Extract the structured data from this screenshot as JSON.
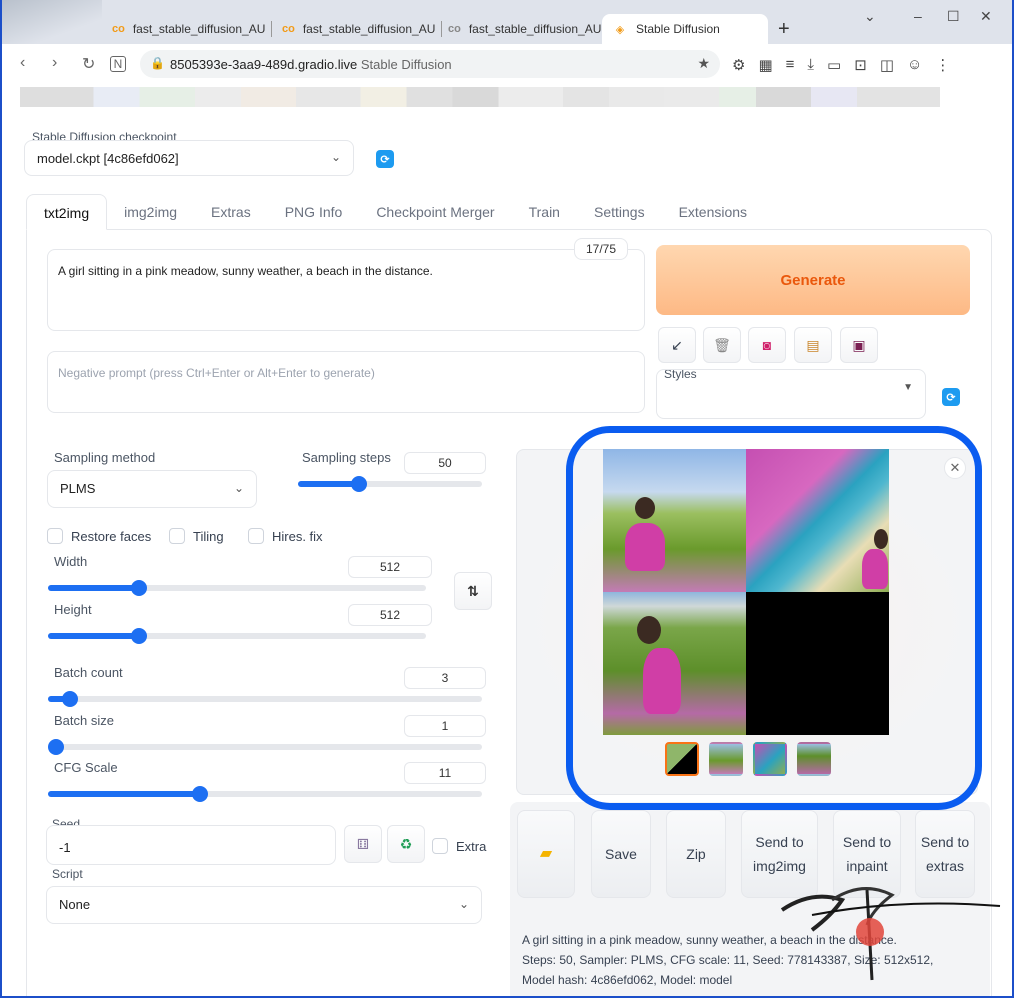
{
  "browser": {
    "tabs": [
      {
        "title": "fast_stable_diffusion_AU",
        "icon": "co-icon"
      },
      {
        "title": "fast_stable_diffusion_AU",
        "icon": "co-icon"
      },
      {
        "title": "fast_stable_diffusion_AU",
        "icon": "co-icon"
      },
      {
        "title": "Stable Diffusion",
        "icon": "gradio-icon"
      }
    ],
    "url_host": "8505393e-3aa9-489d.gradio.live",
    "url_title": "Stable Diffusion"
  },
  "checkpoint": {
    "label": "Stable Diffusion checkpoint",
    "value": "model.ckpt [4c86efd062]"
  },
  "main_tabs": [
    "txt2img",
    "img2img",
    "Extras",
    "PNG Info",
    "Checkpoint Merger",
    "Train",
    "Settings",
    "Extensions"
  ],
  "prompt": {
    "text": "A girl sitting in a pink meadow, sunny weather, a beach in the distance.",
    "counter": "17/75",
    "negative_placeholder": "Negative prompt (press Ctrl+Enter or Alt+Enter to generate)"
  },
  "generate_label": "Generate",
  "styles_label": "Styles",
  "sampling": {
    "method_label": "Sampling method",
    "method_value": "PLMS",
    "steps_label": "Sampling steps",
    "steps_value": "50",
    "steps_fraction": 0.33
  },
  "checkboxes": [
    "Restore faces",
    "Tiling",
    "Hires. fix"
  ],
  "width": {
    "label": "Width",
    "value": "512",
    "fraction": 0.24
  },
  "height": {
    "label": "Height",
    "value": "512",
    "fraction": 0.24
  },
  "batch_count": {
    "label": "Batch count",
    "value": "3",
    "fraction": 0.05
  },
  "batch_size": {
    "label": "Batch size",
    "value": "1",
    "fraction": 0.0
  },
  "cfg_scale": {
    "label": "CFG Scale",
    "value": "11",
    "fraction": 0.35
  },
  "seed": {
    "label": "Seed",
    "value": "-1",
    "extra_label": "Extra"
  },
  "script": {
    "label": "Script",
    "value": "None"
  },
  "actions": {
    "save": "Save",
    "zip": "Zip",
    "send_img2img": "Send to img2img",
    "send_inpaint": "Send to inpaint",
    "send_extras": "Send to extras"
  },
  "generation_info": {
    "line1": "A girl sitting in a pink meadow, sunny weather, a beach in the distance.",
    "line2": "Steps: 50, Sampler: PLMS, CFG scale: 11, Seed: 778143387, Size: 512x512,",
    "line3": "Model hash: 4c86efd062, Model: model"
  },
  "colors": {
    "accent": "#1d6ff2",
    "generate_text": "#ea580c",
    "highlight_ring": "#0a5cf0"
  }
}
